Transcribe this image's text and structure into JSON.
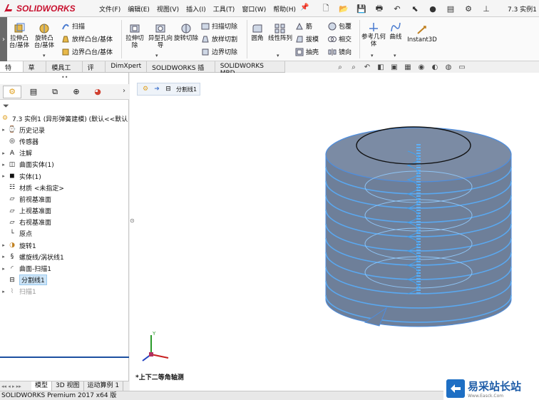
{
  "app": {
    "brand": "SOLIDWORKS",
    "window_title": "7.3 实例1"
  },
  "menu": [
    "文件(F)",
    "编辑(E)",
    "视图(V)",
    "插入(I)",
    "工具(T)",
    "窗口(W)",
    "帮助(H)"
  ],
  "commands": {
    "extrude_boss": "拉伸凸台/基体",
    "revolve_boss": "旋转凸台/基体",
    "sweep": "扫描",
    "loft_boss": "放样凸台/基体",
    "boundary_boss": "边界凸台/基体",
    "extrude_cut": "拉伸切除",
    "hole_wizard": "异型孔向导",
    "revolve_cut": "旋转切除",
    "swept_cut": "扫描切除",
    "lofted_cut": "放样切割",
    "boundary_cut": "边界切除",
    "fillet": "圆角",
    "linear_pattern": "线性阵列",
    "rib": "筋",
    "draft": "拔模",
    "shell": "抽壳",
    "wrap": "包覆",
    "intersect": "相交",
    "mirror": "镜向",
    "ref_geometry": "参考几何体",
    "curves": "曲线",
    "instant3d": "Instant3D"
  },
  "tabs": [
    "特征",
    "草图",
    "模具工具",
    "评估",
    "DimXpert",
    "SOLIDWORKS 插件",
    "SOLIDWORKS MBD"
  ],
  "tree": {
    "root": "7.3 实例1 (异形弹簧建模) (默认<<默认",
    "items": [
      {
        "label": "历史记录",
        "icon": "history-icon"
      },
      {
        "label": "传感器",
        "icon": "sensor-icon"
      },
      {
        "label": "注解",
        "icon": "annotation-icon"
      },
      {
        "label": "曲面实体(1)",
        "icon": "surface-body-icon"
      },
      {
        "label": "实体(1)",
        "icon": "solid-body-icon"
      },
      {
        "label": "材质 <未指定>",
        "icon": "material-icon"
      },
      {
        "label": "前视基准面",
        "icon": "plane-icon"
      },
      {
        "label": "上视基准面",
        "icon": "plane-icon"
      },
      {
        "label": "右视基准面",
        "icon": "plane-icon"
      },
      {
        "label": "原点",
        "icon": "origin-icon"
      },
      {
        "label": "旋转1",
        "icon": "revolve-icon"
      },
      {
        "label": "螺旋线/涡状线1",
        "icon": "helix-icon"
      },
      {
        "label": "曲面-扫描1",
        "icon": "surface-sweep-icon"
      },
      {
        "label": "分割线1",
        "icon": "split-line-icon"
      },
      {
        "label": "扫描1",
        "icon": "sweep-icon"
      }
    ]
  },
  "breadcrumb": {
    "label": "分割线1"
  },
  "view_label": "*上下二等角轴测",
  "bottom_tabs": [
    "模型",
    "3D 视图",
    "运动算例 1"
  ],
  "status": "SOLIDWORKS Premium 2017 x64 版",
  "watermark": {
    "title": "易采站长站",
    "sub": "Www.Easck.Com"
  },
  "colors": {
    "accent": "#1c4fa0",
    "model_fill": "#6e7f99",
    "helix": "#3fa0f0",
    "brand": "#c8102e"
  }
}
